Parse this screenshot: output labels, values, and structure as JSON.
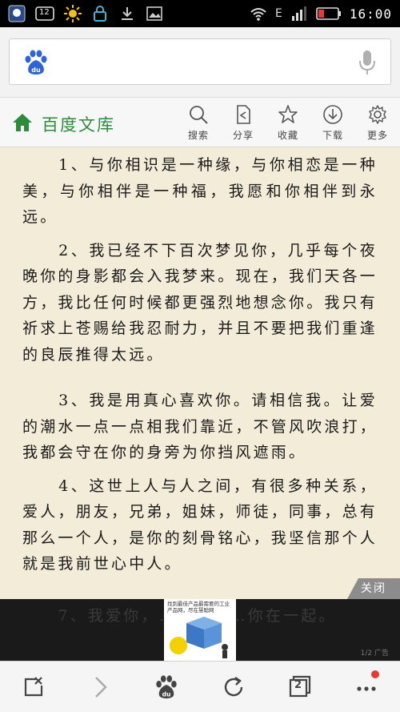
{
  "status_bar": {
    "notification_count": "12",
    "network": "E",
    "time": "16:00"
  },
  "search": {
    "placeholder": ""
  },
  "wenku": {
    "title": "百度文库",
    "tools": [
      {
        "label": "搜索",
        "icon": "search-icon"
      },
      {
        "label": "分享",
        "icon": "share-icon"
      },
      {
        "label": "收藏",
        "icon": "star-icon"
      },
      {
        "label": "下载",
        "icon": "download-icon"
      },
      {
        "label": "更多",
        "icon": "gear-icon"
      }
    ]
  },
  "content": {
    "paragraphs": [
      "　　1、与你相识是一种缘，与你相恋是一种美，与你相伴是一种福，我愿和你相伴到永远。",
      "　　2、我已经不下百次梦见你，几乎每个夜晚你的身影都会入我梦来。现在，我们天各一方，我比任何时候都更强烈地想念你。我只有祈求上苍赐给我忍耐力，并且不要把我们重逢的良辰推得太远。",
      "　　3、我是用真心喜欢你。请相信我。让爱的潮水一点一点相我们靠近，不管风吹浪打，我都会守在你的身旁为你挡风遮雨。",
      "　　4、这世上人与人之间，有很多种关系，爱人，朋友，兄弟，姐妹，师徒，同事，总有那么一个人，是你的刻骨铭心，我坚信那个人就是我前世心中人。"
    ],
    "partial_line": "　　7、我爱你，……………你在一起。"
  },
  "ad": {
    "close_label": "关闭",
    "caption": "找到最佳产品最需要的工业产品网，尽在慧聪网",
    "sub_text": "1/2 广告"
  },
  "bottom_nav": {
    "tabs_count": "2"
  },
  "colors": {
    "accent_green": "#2e8b3a",
    "reader_bg": "#f3ecd8",
    "notification_dot": "#e53935"
  }
}
